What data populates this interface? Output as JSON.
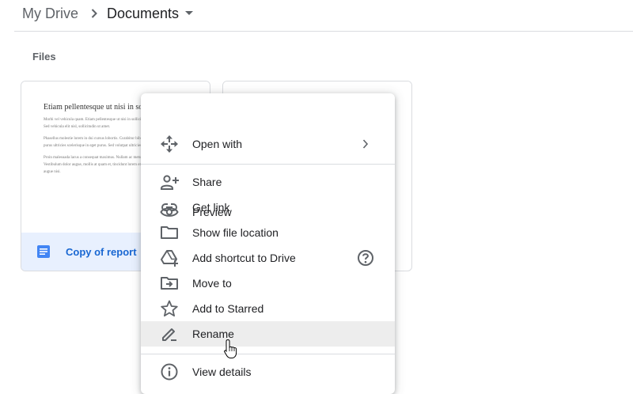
{
  "breadcrumb": {
    "root": "My Drive",
    "current": "Documents"
  },
  "section_title": "Files",
  "files": [
    {
      "name": "Copy of report",
      "preview": {
        "title": "Etiam pellentesque ut nisi in sollicitudin",
        "paragraphs": [
          "Morbi vel vehicula quam. Etiam pellentesque ut nisi in sollicitudin. Nam eu auctor dictum placerat. Sed vehicula elit nisl, sollicitudin ut amet.",
          "Phasellus molestie lorem in dui cursus lobortis. Curabitur bibendum urna at ullamcorper. Mauris at purus ultricies scelerisque in eget purus. Sed volutpat ultricies molestie.",
          "Proin malesuada lacus a consequat maximus. Nullam ac metus sed diam consectetur consectetur. Vestibulum dolor augue, mollis at quam et, tincidunt lorem eros sollicitudin mi, et amet convallis augue nisi."
        ]
      }
    }
  ],
  "context_menu": {
    "items": [
      {
        "label": "Preview",
        "icon": "eye-icon"
      },
      {
        "label": "Open with",
        "icon": "move-arrows-icon",
        "trailing": "chevron-right-icon"
      },
      {
        "label": "Share",
        "icon": "person-add-icon"
      },
      {
        "label": "Get link",
        "icon": "link-icon"
      },
      {
        "label": "Show file location",
        "icon": "folder-icon"
      },
      {
        "label": "Add shortcut to Drive",
        "icon": "drive-shortcut-icon",
        "trailing": "help-icon"
      },
      {
        "label": "Move to",
        "icon": "folder-move-icon"
      },
      {
        "label": "Add to Starred",
        "icon": "star-icon"
      },
      {
        "label": "Rename",
        "icon": "pencil-icon",
        "highlighted": true
      },
      {
        "label": "View details",
        "icon": "info-icon"
      }
    ]
  },
  "colors": {
    "accent": "#1967d2",
    "doc_icon": "#4285f4",
    "card_footer": "#e8f0fe",
    "hover": "#ededed"
  }
}
